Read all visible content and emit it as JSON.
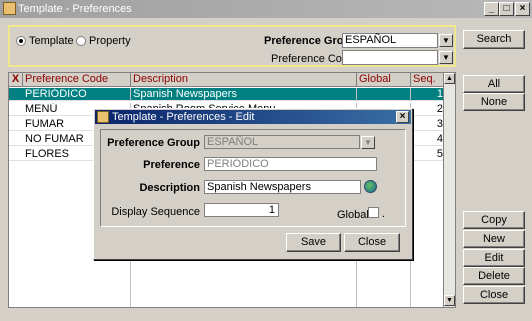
{
  "window": {
    "title": "Template - Preferences",
    "minimize": "_",
    "maximize": "□",
    "close": "×"
  },
  "filter": {
    "radio_template": "Template",
    "radio_property": "Property",
    "pref_group_label": "Preference Group",
    "pref_group_value": "ESPAÑOL",
    "pref_code_label": "Preference Code",
    "pref_code_value": ""
  },
  "grid": {
    "columns": [
      "X",
      "Preference Code",
      "Description",
      "Global",
      "Seq."
    ],
    "rows": [
      {
        "code": "PERIÓDICO",
        "description": "Spanish Newspapers",
        "seq": "1"
      },
      {
        "code": "MENÚ",
        "description": "Spanish Room Service Menu",
        "seq": "2"
      },
      {
        "code": "FUMAR",
        "description": "",
        "seq": "3"
      },
      {
        "code": "NO FUMAR",
        "description": "",
        "seq": "4"
      },
      {
        "code": "FLORES",
        "description": "",
        "seq": "5"
      }
    ]
  },
  "side_buttons": {
    "search": "Search",
    "all": "All",
    "none": "None",
    "copy": "Copy",
    "new": "New",
    "edit": "Edit",
    "delete": "Delete",
    "close": "Close"
  },
  "dialog": {
    "title": "Template - Preferences - Edit",
    "pref_group_label": "Preference Group",
    "pref_group_value": "ESPAÑOL",
    "preference_label": "Preference",
    "preference_value": "PERIÓDICO",
    "description_label": "Description",
    "description_value": "Spanish Newspapers",
    "display_seq_label": "Display Sequence",
    "display_seq_value": "1",
    "global_label": "Global",
    "save": "Save",
    "close": "Close"
  }
}
